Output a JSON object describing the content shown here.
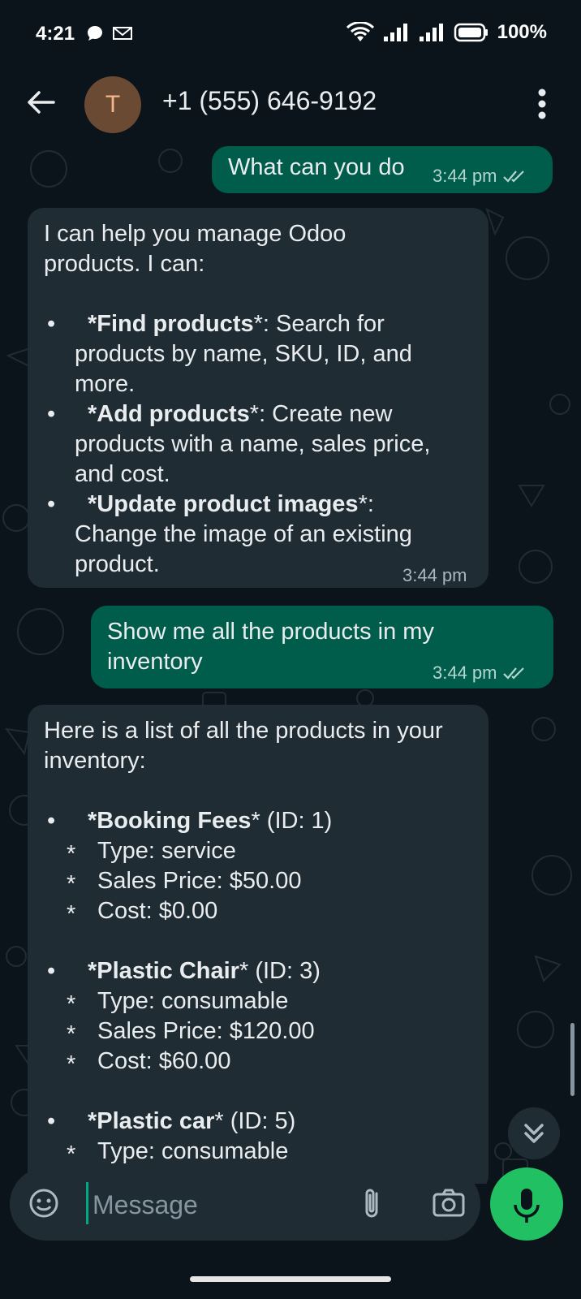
{
  "status_bar": {
    "time": "4:21",
    "battery": "100%",
    "icons": [
      "chat-bubble-icon",
      "gmail-icon",
      "wifi-icon",
      "signal-icon",
      "signal-icon",
      "battery-icon"
    ]
  },
  "header": {
    "avatar_initial": "T",
    "contact": "+1 (555) 646-9192"
  },
  "messages": [
    {
      "from": "me",
      "text": "What can you do",
      "time": "3:44 pm",
      "status": "read"
    },
    {
      "from": "bot",
      "intro_line1": "I can help you manage Odoo",
      "intro_line2": "products. I can:",
      "items": [
        {
          "bold": "*Find products",
          "rest_a": "*: Search for",
          "rest_b": "products by name, SKU, ID, and",
          "rest_c": "more."
        },
        {
          "bold": "*Add products",
          "rest_a": "*: Create new",
          "rest_b": "products with a name, sales price,",
          "rest_c": "and cost."
        },
        {
          "bold": "*Update product images",
          "rest_a": "*:",
          "rest_b": "Change the image of an existing",
          "rest_c": "product."
        }
      ],
      "time": "3:44 pm"
    },
    {
      "from": "me",
      "text_line1": "Show me all the products in my",
      "text_line2": "inventory",
      "time": "3:44 pm",
      "status": "read"
    },
    {
      "from": "bot",
      "intro_line1": "Here is a list of all the products in your",
      "intro_line2": "inventory:",
      "products": [
        {
          "name": "*Booking Fees",
          "id": "* (ID: 1)",
          "type": "Type: service",
          "price": "Sales Price: $50.00",
          "cost": "Cost: $0.00"
        },
        {
          "name": "*Plastic Chair",
          "id": "* (ID: 3)",
          "type": "Type: consumable",
          "price": "Sales Price: $120.00",
          "cost": "Cost: $60.00"
        },
        {
          "name": "*Plastic car",
          "id": "* (ID: 5)",
          "type": "Type: consumable"
        }
      ]
    }
  ],
  "composer": {
    "placeholder": "Message"
  },
  "colors": {
    "outgoing": "#005c4b",
    "incoming": "#202c33",
    "accent": "#21c063",
    "background": "#0b141a"
  }
}
